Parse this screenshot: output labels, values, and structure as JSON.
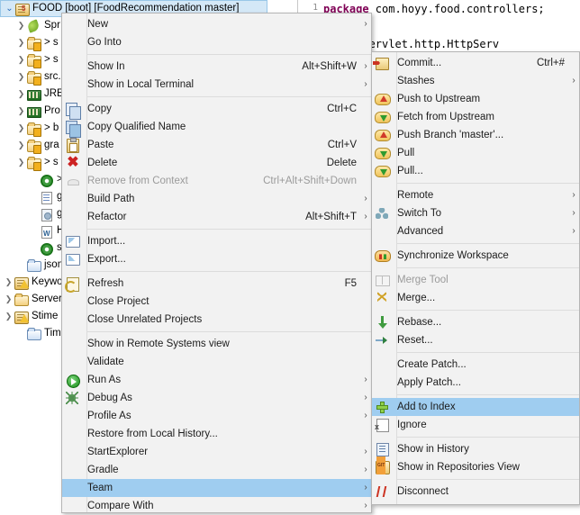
{
  "editor": {
    "line_number": "1",
    "line1_keyword": "package",
    "line1_rest": " com.hoyy.food.controllers;",
    "line2_text": "javax.servlet.http.HttpServ"
  },
  "tree": {
    "items": [
      {
        "label": "FOOD [boot] [FoodRecommendation master]",
        "icon": "java-project-icon",
        "indent": 0,
        "twisty": "open",
        "selected": true
      },
      {
        "label": "Spr",
        "icon": "spring-leaf-icon",
        "indent": 1,
        "twisty": "closed",
        "selected": false
      },
      {
        "label": "> s",
        "icon": "source-folder-icon",
        "indent": 1,
        "twisty": "closed",
        "selected": false
      },
      {
        "label": "> s",
        "icon": "source-folder-icon",
        "indent": 1,
        "twisty": "closed",
        "selected": false
      },
      {
        "label": "src.",
        "icon": "source-folder-icon",
        "indent": 1,
        "twisty": "closed",
        "selected": false
      },
      {
        "label": "JRE",
        "icon": "jre-library-icon",
        "indent": 1,
        "twisty": "closed",
        "selected": false
      },
      {
        "label": "Pro",
        "icon": "library-icon",
        "indent": 1,
        "twisty": "closed",
        "selected": false
      },
      {
        "label": "> b",
        "icon": "folder-icon",
        "indent": 1,
        "twisty": "closed",
        "selected": false
      },
      {
        "label": "gra",
        "icon": "folder-icon",
        "indent": 1,
        "twisty": "closed",
        "selected": false
      },
      {
        "label": "> s",
        "icon": "folder-icon",
        "indent": 1,
        "twisty": "closed",
        "selected": false
      },
      {
        "label": "> b",
        "icon": "gradle-build-icon",
        "indent": 2,
        "twisty": "none",
        "selected": false
      },
      {
        "label": "gra",
        "icon": "file-icon",
        "indent": 2,
        "twisty": "none",
        "selected": false
      },
      {
        "label": "gra",
        "icon": "properties-file-icon",
        "indent": 2,
        "twisty": "none",
        "selected": false
      },
      {
        "label": "HE",
        "icon": "word-file-icon",
        "indent": 2,
        "twisty": "none",
        "selected": false
      },
      {
        "label": "set",
        "icon": "gradle-build-icon",
        "indent": 2,
        "twisty": "none",
        "selected": false
      },
      {
        "label": "json",
        "icon": "folder-plain-icon",
        "indent": 1,
        "twisty": "none",
        "selected": false
      },
      {
        "label": "Keywo",
        "icon": "java-project-warning-icon",
        "indent": 0,
        "twisty": "closed",
        "selected": false
      },
      {
        "label": "Server",
        "icon": "server-folder-icon",
        "indent": 0,
        "twisty": "closed",
        "selected": false
      },
      {
        "label": "Stime",
        "icon": "java-project-warning-icon",
        "indent": 0,
        "twisty": "closed",
        "selected": false
      },
      {
        "label": "Timec",
        "icon": "folder-plain-icon",
        "indent": 1,
        "twisty": "none",
        "selected": false
      }
    ]
  },
  "context_menu": {
    "items": [
      {
        "type": "item",
        "label": "New",
        "accel": "",
        "arrow": true,
        "icon": "",
        "disabled": false,
        "highlight": false,
        "name": "menu-item-new"
      },
      {
        "type": "item",
        "label": "Go Into",
        "accel": "",
        "arrow": false,
        "icon": "",
        "disabled": false,
        "highlight": false,
        "name": "menu-item-go-into"
      },
      {
        "type": "sep"
      },
      {
        "type": "item",
        "label": "Show In",
        "accel": "Alt+Shift+W",
        "arrow": true,
        "icon": "",
        "disabled": false,
        "highlight": false,
        "name": "menu-item-show-in"
      },
      {
        "type": "item",
        "label": "Show in Local Terminal",
        "accel": "",
        "arrow": true,
        "icon": "",
        "disabled": false,
        "highlight": false,
        "name": "menu-item-show-in-local-terminal"
      },
      {
        "type": "sep"
      },
      {
        "type": "item",
        "label": "Copy",
        "accel": "Ctrl+C",
        "arrow": false,
        "icon": "copy-icon",
        "disabled": false,
        "highlight": false,
        "name": "menu-item-copy"
      },
      {
        "type": "item",
        "label": "Copy Qualified Name",
        "accel": "",
        "arrow": false,
        "icon": "copy-qualified-name-icon",
        "disabled": false,
        "highlight": false,
        "name": "menu-item-copy-qualified-name"
      },
      {
        "type": "item",
        "label": "Paste",
        "accel": "Ctrl+V",
        "arrow": false,
        "icon": "paste-icon",
        "disabled": false,
        "highlight": false,
        "name": "menu-item-paste"
      },
      {
        "type": "item",
        "label": "Delete",
        "accel": "Delete",
        "arrow": false,
        "icon": "delete-icon",
        "disabled": false,
        "highlight": false,
        "name": "menu-item-delete"
      },
      {
        "type": "item",
        "label": "Remove from Context",
        "accel": "Ctrl+Alt+Shift+Down",
        "arrow": false,
        "icon": "remove-from-context-icon",
        "disabled": true,
        "highlight": false,
        "name": "menu-item-remove-from-context"
      },
      {
        "type": "item",
        "label": "Build Path",
        "accel": "",
        "arrow": true,
        "icon": "",
        "disabled": false,
        "highlight": false,
        "name": "menu-item-build-path"
      },
      {
        "type": "item",
        "label": "Refactor",
        "accel": "Alt+Shift+T",
        "arrow": true,
        "icon": "",
        "disabled": false,
        "highlight": false,
        "name": "menu-item-refactor"
      },
      {
        "type": "sep"
      },
      {
        "type": "item",
        "label": "Import...",
        "accel": "",
        "arrow": false,
        "icon": "import-icon",
        "disabled": false,
        "highlight": false,
        "name": "menu-item-import"
      },
      {
        "type": "item",
        "label": "Export...",
        "accel": "",
        "arrow": false,
        "icon": "export-icon",
        "disabled": false,
        "highlight": false,
        "name": "menu-item-export"
      },
      {
        "type": "sep"
      },
      {
        "type": "item",
        "label": "Refresh",
        "accel": "F5",
        "arrow": false,
        "icon": "refresh-icon",
        "disabled": false,
        "highlight": false,
        "name": "menu-item-refresh"
      },
      {
        "type": "item",
        "label": "Close Project",
        "accel": "",
        "arrow": false,
        "icon": "",
        "disabled": false,
        "highlight": false,
        "name": "menu-item-close-project"
      },
      {
        "type": "item",
        "label": "Close Unrelated Projects",
        "accel": "",
        "arrow": false,
        "icon": "",
        "disabled": false,
        "highlight": false,
        "name": "menu-item-close-unrelated-projects"
      },
      {
        "type": "sep"
      },
      {
        "type": "item",
        "label": "Show in Remote Systems view",
        "accel": "",
        "arrow": false,
        "icon": "",
        "disabled": false,
        "highlight": false,
        "name": "menu-item-show-in-remote-systems-view"
      },
      {
        "type": "item",
        "label": "Validate",
        "accel": "",
        "arrow": false,
        "icon": "",
        "disabled": false,
        "highlight": false,
        "name": "menu-item-validate"
      },
      {
        "type": "item",
        "label": "Run As",
        "accel": "",
        "arrow": true,
        "icon": "run-icon",
        "disabled": false,
        "highlight": false,
        "name": "menu-item-run-as"
      },
      {
        "type": "item",
        "label": "Debug As",
        "accel": "",
        "arrow": true,
        "icon": "debug-icon",
        "disabled": false,
        "highlight": false,
        "name": "menu-item-debug-as"
      },
      {
        "type": "item",
        "label": "Profile As",
        "accel": "",
        "arrow": true,
        "icon": "",
        "disabled": false,
        "highlight": false,
        "name": "menu-item-profile-as"
      },
      {
        "type": "item",
        "label": "Restore from Local History...",
        "accel": "",
        "arrow": false,
        "icon": "",
        "disabled": false,
        "highlight": false,
        "name": "menu-item-restore-from-local-history"
      },
      {
        "type": "item",
        "label": "StartExplorer",
        "accel": "",
        "arrow": true,
        "icon": "",
        "disabled": false,
        "highlight": false,
        "name": "menu-item-startexplorer"
      },
      {
        "type": "item",
        "label": "Gradle",
        "accel": "",
        "arrow": true,
        "icon": "",
        "disabled": false,
        "highlight": false,
        "name": "menu-item-gradle"
      },
      {
        "type": "item",
        "label": "Team",
        "accel": "",
        "arrow": true,
        "icon": "",
        "disabled": false,
        "highlight": true,
        "name": "menu-item-team"
      },
      {
        "type": "item",
        "label": "Compare With",
        "accel": "",
        "arrow": true,
        "icon": "",
        "disabled": false,
        "highlight": false,
        "name": "menu-item-compare-with"
      }
    ]
  },
  "team_submenu": {
    "items": [
      {
        "type": "item",
        "label": "Commit...",
        "accel": "Ctrl+#",
        "arrow": false,
        "icon": "commit-icon",
        "disabled": false,
        "highlight": false,
        "name": "submenu-item-commit"
      },
      {
        "type": "item",
        "label": "Stashes",
        "accel": "",
        "arrow": true,
        "icon": "",
        "disabled": false,
        "highlight": false,
        "name": "submenu-item-stashes"
      },
      {
        "type": "item",
        "label": "Push to Upstream",
        "accel": "",
        "arrow": false,
        "icon": "push-icon",
        "disabled": false,
        "highlight": false,
        "name": "submenu-item-push-to-upstream"
      },
      {
        "type": "item",
        "label": "Fetch from Upstream",
        "accel": "",
        "arrow": false,
        "icon": "fetch-icon",
        "disabled": false,
        "highlight": false,
        "name": "submenu-item-fetch-from-upstream"
      },
      {
        "type": "item",
        "label": "Push Branch 'master'...",
        "accel": "",
        "arrow": false,
        "icon": "push-icon",
        "disabled": false,
        "highlight": false,
        "name": "submenu-item-push-branch-master"
      },
      {
        "type": "item",
        "label": "Pull",
        "accel": "",
        "arrow": false,
        "icon": "pull-icon",
        "disabled": false,
        "highlight": false,
        "name": "submenu-item-pull"
      },
      {
        "type": "item",
        "label": "Pull...",
        "accel": "",
        "arrow": false,
        "icon": "pull-dialog-icon",
        "disabled": false,
        "highlight": false,
        "name": "submenu-item-pull-dialog"
      },
      {
        "type": "sep"
      },
      {
        "type": "item",
        "label": "Remote",
        "accel": "",
        "arrow": true,
        "icon": "",
        "disabled": false,
        "highlight": false,
        "name": "submenu-item-remote"
      },
      {
        "type": "item",
        "label": "Switch To",
        "accel": "",
        "arrow": true,
        "icon": "switch-to-icon",
        "disabled": false,
        "highlight": false,
        "name": "submenu-item-switch-to"
      },
      {
        "type": "item",
        "label": "Advanced",
        "accel": "",
        "arrow": true,
        "icon": "",
        "disabled": false,
        "highlight": false,
        "name": "submenu-item-advanced"
      },
      {
        "type": "sep"
      },
      {
        "type": "item",
        "label": "Synchronize Workspace",
        "accel": "",
        "arrow": false,
        "icon": "synchronize-icon",
        "disabled": false,
        "highlight": false,
        "name": "submenu-item-synchronize-workspace"
      },
      {
        "type": "sep"
      },
      {
        "type": "item",
        "label": "Merge Tool",
        "accel": "",
        "arrow": false,
        "icon": "merge-tool-icon",
        "disabled": true,
        "highlight": false,
        "name": "submenu-item-merge-tool"
      },
      {
        "type": "item",
        "label": "Merge...",
        "accel": "",
        "arrow": false,
        "icon": "merge-icon",
        "disabled": false,
        "highlight": false,
        "name": "submenu-item-merge"
      },
      {
        "type": "sep"
      },
      {
        "type": "item",
        "label": "Rebase...",
        "accel": "",
        "arrow": false,
        "icon": "rebase-icon",
        "disabled": false,
        "highlight": false,
        "name": "submenu-item-rebase"
      },
      {
        "type": "item",
        "label": "Reset...",
        "accel": "",
        "arrow": false,
        "icon": "reset-icon",
        "disabled": false,
        "highlight": false,
        "name": "submenu-item-reset"
      },
      {
        "type": "sep"
      },
      {
        "type": "item",
        "label": "Create Patch...",
        "accel": "",
        "arrow": false,
        "icon": "",
        "disabled": false,
        "highlight": false,
        "name": "submenu-item-create-patch"
      },
      {
        "type": "item",
        "label": "Apply Patch...",
        "accel": "",
        "arrow": false,
        "icon": "",
        "disabled": false,
        "highlight": false,
        "name": "submenu-item-apply-patch"
      },
      {
        "type": "sep"
      },
      {
        "type": "item",
        "label": "Add to Index",
        "accel": "",
        "arrow": false,
        "icon": "add-to-index-icon",
        "disabled": false,
        "highlight": true,
        "name": "submenu-item-add-to-index"
      },
      {
        "type": "item",
        "label": "Ignore",
        "accel": "",
        "arrow": false,
        "icon": "ignore-icon",
        "disabled": false,
        "highlight": false,
        "name": "submenu-item-ignore"
      },
      {
        "type": "sep"
      },
      {
        "type": "item",
        "label": "Show in History",
        "accel": "",
        "arrow": false,
        "icon": "show-in-history-icon",
        "disabled": false,
        "highlight": false,
        "name": "submenu-item-show-in-history"
      },
      {
        "type": "item",
        "label": "Show in Repositories View",
        "accel": "",
        "arrow": false,
        "icon": "show-in-repositories-view-icon",
        "disabled": false,
        "highlight": false,
        "name": "submenu-item-show-in-repositories-view"
      },
      {
        "type": "sep"
      },
      {
        "type": "item",
        "label": "Disconnect",
        "accel": "",
        "arrow": false,
        "icon": "disconnect-icon",
        "disabled": false,
        "highlight": false,
        "name": "submenu-item-disconnect"
      }
    ]
  },
  "colors": {
    "menu_bg": "#f2f2f2",
    "menu_border": "#b5b5b5",
    "highlight": "#9fcdf0",
    "tree_selection": "#d4e8f7",
    "disabled_text": "#9b9b9b",
    "keyword": "#7f0055"
  }
}
